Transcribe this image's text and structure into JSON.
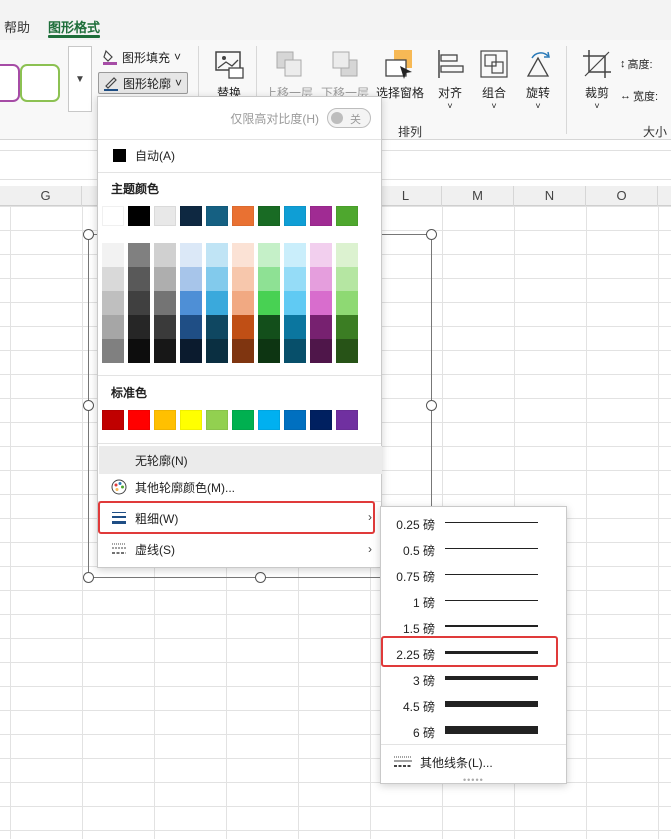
{
  "tabs": {
    "help": "帮助",
    "shape_format": "图形格式"
  },
  "ribbon": {
    "fill_label": "图形填充",
    "outline_label": "图形轮廓",
    "replace_label": "替换",
    "bring_forward": "上移一层",
    "send_backward": "下移一层",
    "selection_pane": "选择窗格",
    "align": "对齐",
    "group": "组合",
    "rotate": "旋转",
    "arrange_group": "排列",
    "crop": "裁剪",
    "height_label": "高度:",
    "width_label": "宽度:",
    "size_group": "大小"
  },
  "columns": [
    "G",
    "L",
    "M",
    "N",
    "O"
  ],
  "outline_menu": {
    "high_contrast_label": "仅限高对比度(H)",
    "high_contrast_state": "关",
    "automatic": "自动(A)",
    "theme_colors_title": "主题颜色",
    "standard_colors_title": "标准色",
    "no_outline": "无轮廓(N)",
    "more_colors": "其他轮廓颜色(M)...",
    "weight": "粗细(W)",
    "dashes": "虚线(S)",
    "theme_colors": [
      "#ffffff",
      "#000000",
      "#e8e8e8",
      "#0e2841",
      "#156082",
      "#e97132",
      "#196b24",
      "#0f9ed5",
      "#a02b93",
      "#4ea72e"
    ],
    "theme_tints": [
      [
        "#f2f2f2",
        "#d9d9d9",
        "#bfbfbf",
        "#a6a6a6",
        "#808080"
      ],
      [
        "#808080",
        "#595959",
        "#404040",
        "#262626",
        "#0d0d0d"
      ],
      [
        "#d0d0d0",
        "#aeaeae",
        "#747474",
        "#3a3a3a",
        "#171717"
      ],
      [
        "#dbe8f7",
        "#a7c5ea",
        "#4e8fd6",
        "#1f4e85",
        "#0b1b2e"
      ],
      [
        "#c0e4f5",
        "#82caec",
        "#3aa9dc",
        "#0f4761",
        "#0a2f41"
      ],
      [
        "#fbe2d5",
        "#f7c7ac",
        "#f1a982",
        "#c04f15",
        "#7f3510"
      ],
      [
        "#c5f0c8",
        "#8ee194",
        "#48d153",
        "#134f1b",
        "#0d3512"
      ],
      [
        "#caeefb",
        "#95dcf7",
        "#60caf3",
        "#0b769f",
        "#074f6a"
      ],
      [
        "#f2cfee",
        "#e59edd",
        "#d86dcd",
        "#772170",
        "#4f164a"
      ],
      [
        "#dcf2d0",
        "#b5e6a2",
        "#8ed973",
        "#3b7d23",
        "#275317"
      ]
    ],
    "standard_colors": [
      "#c00000",
      "#ff0000",
      "#ffc000",
      "#ffff00",
      "#92d050",
      "#00b050",
      "#00b0f0",
      "#0070c0",
      "#002060",
      "#7030a0"
    ]
  },
  "weight_menu": {
    "items": [
      {
        "label": "0.25 磅",
        "pt": 0.25
      },
      {
        "label": "0.5 磅",
        "pt": 0.5
      },
      {
        "label": "0.75 磅",
        "pt": 0.75
      },
      {
        "label": "1 磅",
        "pt": 1
      },
      {
        "label": "1.5 磅",
        "pt": 1.5
      },
      {
        "label": "2.25 磅",
        "pt": 2.25
      },
      {
        "label": "3 磅",
        "pt": 3
      },
      {
        "label": "4.5 磅",
        "pt": 4.5
      },
      {
        "label": "6 磅",
        "pt": 6
      }
    ],
    "more_lines": "其他线条(L)..."
  }
}
